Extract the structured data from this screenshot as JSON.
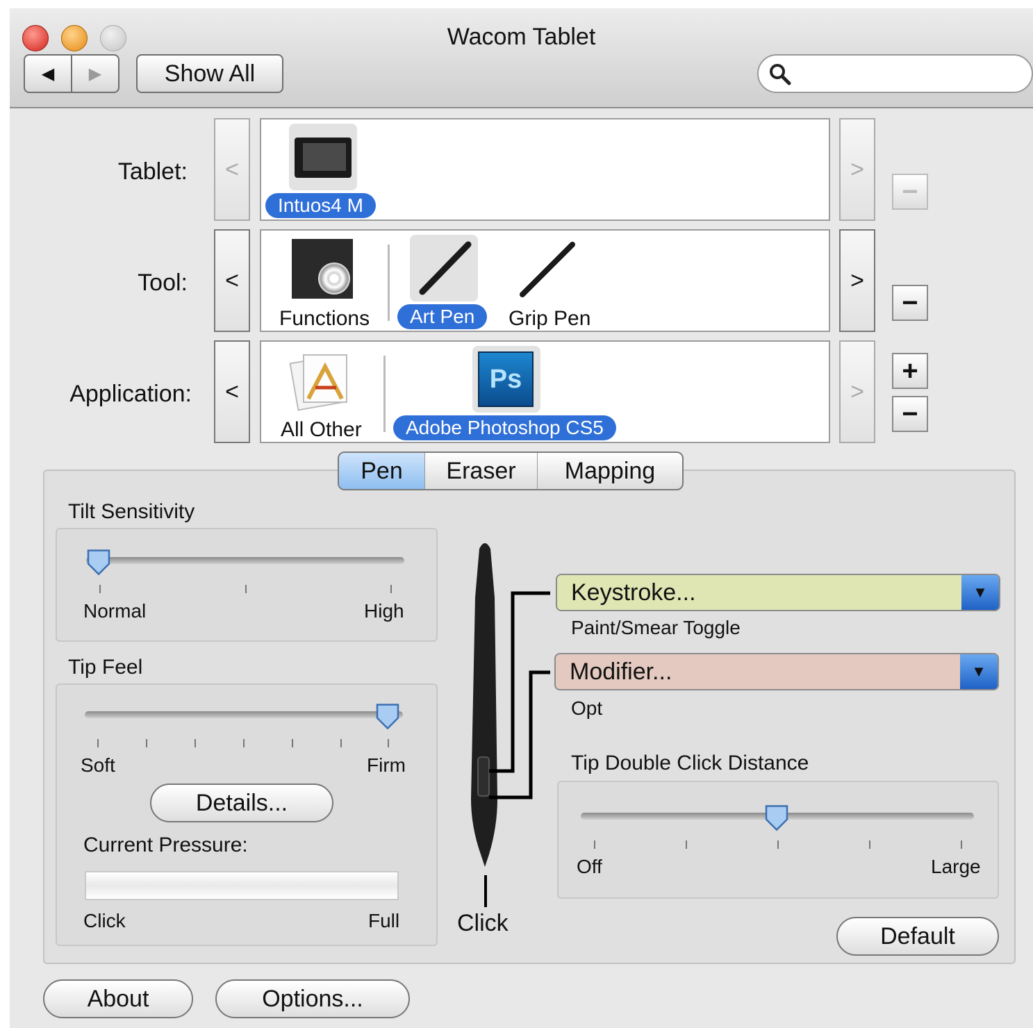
{
  "window": {
    "title": "Wacom Tablet"
  },
  "toolbar": {
    "back_glyph": "◀",
    "forward_glyph": "▶",
    "show_all": "Show All",
    "search_placeholder": "",
    "search_icon": "magnifier-icon"
  },
  "rows": {
    "tablet": {
      "label": "Tablet:",
      "prev": "<",
      "next": ">",
      "items": [
        {
          "name": "Intuos4 M",
          "selected": true
        }
      ],
      "remove": "−"
    },
    "tool": {
      "label": "Tool:",
      "prev": "<",
      "next": ">",
      "items": [
        {
          "name": "Functions"
        },
        {
          "name": "Art Pen",
          "selected": true
        },
        {
          "name": "Grip Pen"
        }
      ],
      "remove": "−"
    },
    "application": {
      "label": "Application:",
      "prev": "<",
      "next": ">",
      "items": [
        {
          "name": "All Other"
        },
        {
          "name": "Adobe Photoshop CS5",
          "selected": true
        }
      ],
      "add": "+",
      "remove": "−"
    }
  },
  "ps_icon_text": "Ps",
  "tabs": [
    {
      "label": "Pen",
      "selected": true
    },
    {
      "label": "Eraser"
    },
    {
      "label": "Mapping"
    }
  ],
  "tilt": {
    "title": "Tilt Sensitivity",
    "min_label": "Normal",
    "max_label": "High",
    "value": 0.0
  },
  "tip_feel": {
    "title": "Tip Feel",
    "min_label": "Soft",
    "max_label": "Firm",
    "value": 1.0,
    "details_button": "Details..."
  },
  "pressure": {
    "title": "Current Pressure:",
    "min_label": "Click",
    "max_label": "Full",
    "value": 0.0
  },
  "pen_buttons": {
    "upper": {
      "function": "Keystroke...",
      "detail": "Paint/Smear Toggle",
      "color": "#dfe6b4"
    },
    "lower": {
      "function": "Modifier...",
      "detail": "Opt",
      "color": "#e3c9bf"
    },
    "tip_label": "Click"
  },
  "double_click": {
    "title": "Tip Double Click Distance",
    "min_label": "Off",
    "max_label": "Large",
    "value": 0.5
  },
  "buttons": {
    "default": "Default",
    "about": "About",
    "options": "Options..."
  },
  "colors": {
    "accent": "#2f6fd8",
    "close": "#e0443e",
    "minimize": "#f2a33a",
    "zoom_disabled": "#c8c8c8"
  }
}
